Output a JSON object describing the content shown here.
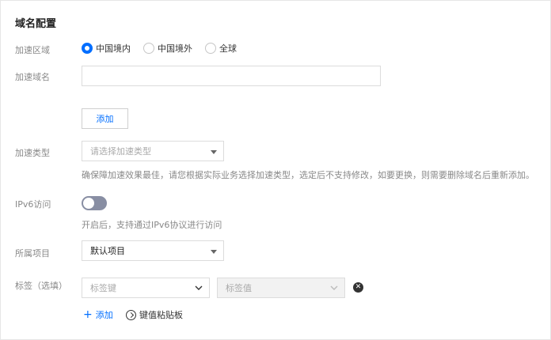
{
  "section_title": "域名配置",
  "region": {
    "label": "加速区域",
    "options": [
      "中国境内",
      "中国境外",
      "全球"
    ],
    "selected": 0
  },
  "domain": {
    "label": "加速域名",
    "value": "",
    "add_button": "添加"
  },
  "accel_type": {
    "label": "加速类型",
    "placeholder": "请选择加速类型",
    "hint": "确保障加速效果最佳，请您根据实际业务选择加速类型，选定后不支持修改，如要更换，则需要删除域名后重新添加。"
  },
  "ipv6": {
    "label": "IPv6访问",
    "enabled": false,
    "hint": "开启后，支持通过IPv6协议进行访问"
  },
  "project": {
    "label": "所属项目",
    "value": "默认项目"
  },
  "tags": {
    "label": "标签（选填）",
    "key_placeholder": "标签键",
    "value_placeholder": "标签值",
    "add_link": "添加",
    "paste_link": "键值粘贴板"
  },
  "colors": {
    "accent": "#006eff",
    "toggle_off": "#888ea3"
  }
}
